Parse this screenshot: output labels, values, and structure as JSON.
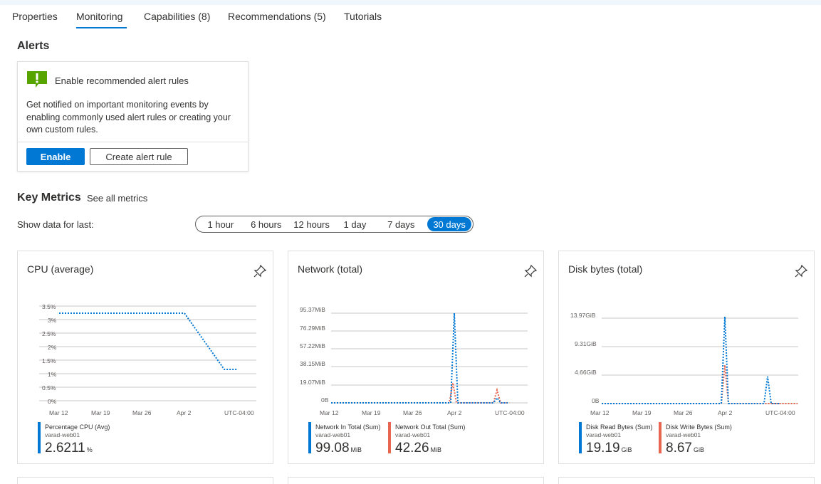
{
  "tabs": [
    {
      "label": "Properties"
    },
    {
      "label": "Monitoring"
    },
    {
      "label": "Capabilities (8)"
    },
    {
      "label": "Recommendations (5)"
    },
    {
      "label": "Tutorials"
    }
  ],
  "active_tab": "Monitoring",
  "alerts": {
    "section_title": "Alerts",
    "card_title": "Enable recommended alert rules",
    "description": "Get notified on important monitoring events by enabling commonly used alert rules or creating your own custom rules.",
    "enable_label": "Enable",
    "create_label": "Create alert rule",
    "icon": "alert-exclamation-icon"
  },
  "key_metrics": {
    "title": "Key Metrics",
    "see_all": "See all metrics",
    "show_data_label": "Show data for last:",
    "ranges": [
      "1 hour",
      "6 hours",
      "12 hours",
      "1 day",
      "7 days",
      "30 days"
    ],
    "selected_range": "30 days"
  },
  "colors": {
    "accent": "#0078d4",
    "series_blue": "#0078d4",
    "series_red": "#e8664f",
    "alert_green": "#57a300"
  },
  "cards": [
    {
      "title": "CPU (average)",
      "legend": [
        {
          "name": "Percentage CPU (Avg)",
          "resource": "varad-web01",
          "value": "2.6211",
          "unit": "%",
          "color": "#0078d4"
        }
      ]
    },
    {
      "title": "Network (total)",
      "legend": [
        {
          "name": "Network In Total (Sum)",
          "resource": "varad-web01",
          "value": "99.08",
          "unit": "MiB",
          "color": "#0078d4"
        },
        {
          "name": "Network Out Total (Sum)",
          "resource": "varad-web01",
          "value": "42.26",
          "unit": "MiB",
          "color": "#e8664f"
        }
      ]
    },
    {
      "title": "Disk bytes (total)",
      "legend": [
        {
          "name": "Disk Read Bytes (Sum)",
          "resource": "varad-web01",
          "value": "19.19",
          "unit": "GiB",
          "color": "#0078d4"
        },
        {
          "name": "Disk Write Bytes (Sum)",
          "resource": "varad-web01",
          "value": "8.67",
          "unit": "GiB",
          "color": "#e8664f"
        }
      ]
    }
  ],
  "chart_data": [
    {
      "type": "line",
      "title": "CPU (average)",
      "x": [
        "Mar 10",
        "Mar 12",
        "Mar 19",
        "Mar 26",
        "Apr 1",
        "Apr 2",
        "Apr 4",
        "Apr 5"
      ],
      "x_tick_labels": [
        "Mar 12",
        "Mar 19",
        "Mar 26",
        "Apr 2",
        "UTC-04:00"
      ],
      "y_tick_labels": [
        "3.5%",
        "3%",
        "2.5%",
        "2%",
        "1.5%",
        "1%",
        "0.5%",
        "0%"
      ],
      "ylim": [
        0,
        3.5
      ],
      "series": [
        {
          "name": "Percentage CPU (Avg)",
          "color": "#0078d4",
          "style": "dotted",
          "points": [
            [
              "Mar 10",
              3.3
            ],
            [
              "Apr 2",
              3.3
            ],
            [
              "Apr 4",
              1.2
            ],
            [
              "Apr 5",
              1.2
            ]
          ]
        }
      ]
    },
    {
      "type": "line",
      "title": "Network (total)",
      "x_tick_labels": [
        "Mar 12",
        "Mar 19",
        "Mar 26",
        "Apr 2",
        "UTC-04:00"
      ],
      "y_tick_labels": [
        "95.37MiB",
        "76.29MiB",
        "57.22MiB",
        "38.15MiB",
        "19.07MiB",
        "0B"
      ],
      "ylim": [
        0,
        95.37
      ],
      "series": [
        {
          "name": "Network In Total (Sum)",
          "color": "#0078d4",
          "style": "dotted",
          "points": [
            [
              "Mar 10",
              0
            ],
            [
              "Apr 1",
              0
            ],
            [
              "Apr 2",
              95
            ],
            [
              "Apr 3",
              0
            ],
            [
              "Apr 6",
              0
            ],
            [
              "Apr 7",
              5
            ],
            [
              "Apr 8",
              0
            ],
            [
              "Apr 10",
              0
            ]
          ]
        },
        {
          "name": "Network Out Total (Sum)",
          "color": "#e8664f",
          "style": "dotted",
          "points": [
            [
              "Mar 10",
              0
            ],
            [
              "Apr 1",
              0
            ],
            [
              "Apr 2",
              20
            ],
            [
              "Apr 3",
              0
            ],
            [
              "Apr 6",
              0
            ],
            [
              "Apr 7",
              14
            ],
            [
              "Apr 8",
              0
            ],
            [
              "Apr 10",
              0
            ]
          ]
        }
      ]
    },
    {
      "type": "line",
      "title": "Disk bytes (total)",
      "x_tick_labels": [
        "Mar 12",
        "Mar 19",
        "Mar 26",
        "Apr 2",
        "UTC-04:00"
      ],
      "y_tick_labels": [
        "13.97GiB",
        "9.31GiB",
        "4.66GiB",
        "0B"
      ],
      "ylim": [
        0,
        13.97
      ],
      "series": [
        {
          "name": "Disk Read Bytes (Sum)",
          "color": "#0078d4",
          "style": "dotted",
          "points": [
            [
              "Mar 10",
              0
            ],
            [
              "Apr 1",
              0
            ],
            [
              "Apr 2",
              14.0
            ],
            [
              "Apr 3",
              0
            ],
            [
              "Apr 8",
              0
            ],
            [
              "Apr 9",
              4.4
            ],
            [
              "Apr 10",
              0
            ],
            [
              "Apr 12",
              0
            ]
          ]
        },
        {
          "name": "Disk Write Bytes (Sum)",
          "color": "#e8664f",
          "style": "dotted",
          "points": [
            [
              "Mar 10",
              0
            ],
            [
              "Apr 1",
              0
            ],
            [
              "Apr 2",
              6.3
            ],
            [
              "Apr 3",
              0
            ],
            [
              "Apr 12",
              0
            ]
          ]
        }
      ]
    }
  ]
}
